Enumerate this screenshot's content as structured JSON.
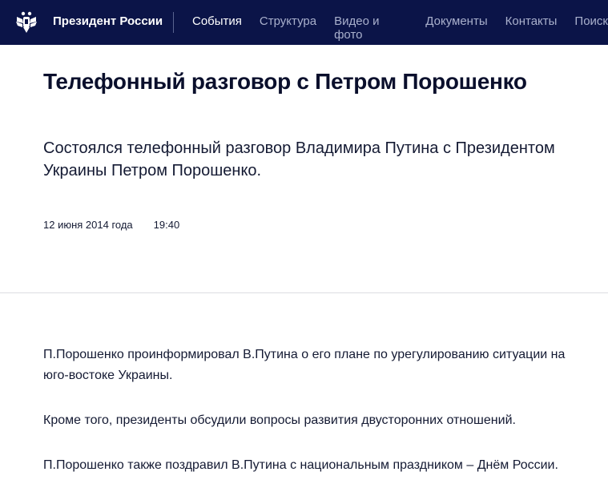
{
  "header": {
    "logo_icon": "russian-eagle-emblem-icon",
    "brand": "Президент России",
    "nav": [
      "События",
      "Структура",
      "Видео и фото",
      "Документы",
      "Контакты",
      "Поиск"
    ],
    "active_nav": "События",
    "background": "#0b1448"
  },
  "article": {
    "title": "Телефонный разговор с Петром Порошенко",
    "lead": "Состоялся телефонный разговор Владимира Путина с Президентом Украины Петром Порошенко.",
    "date": "12 июня 2014 года",
    "time": "19:40",
    "paragraphs": [
      "П.Порошенко проинформировал В.Путина о его плане по урегулированию ситуации на юго-востоке Украины.",
      "Кроме того, президенты обсудили вопросы развития двусторонних отношений.",
      "П.Порошенко также поздравил В.Путина с национальным праздником – Днём России."
    ]
  }
}
